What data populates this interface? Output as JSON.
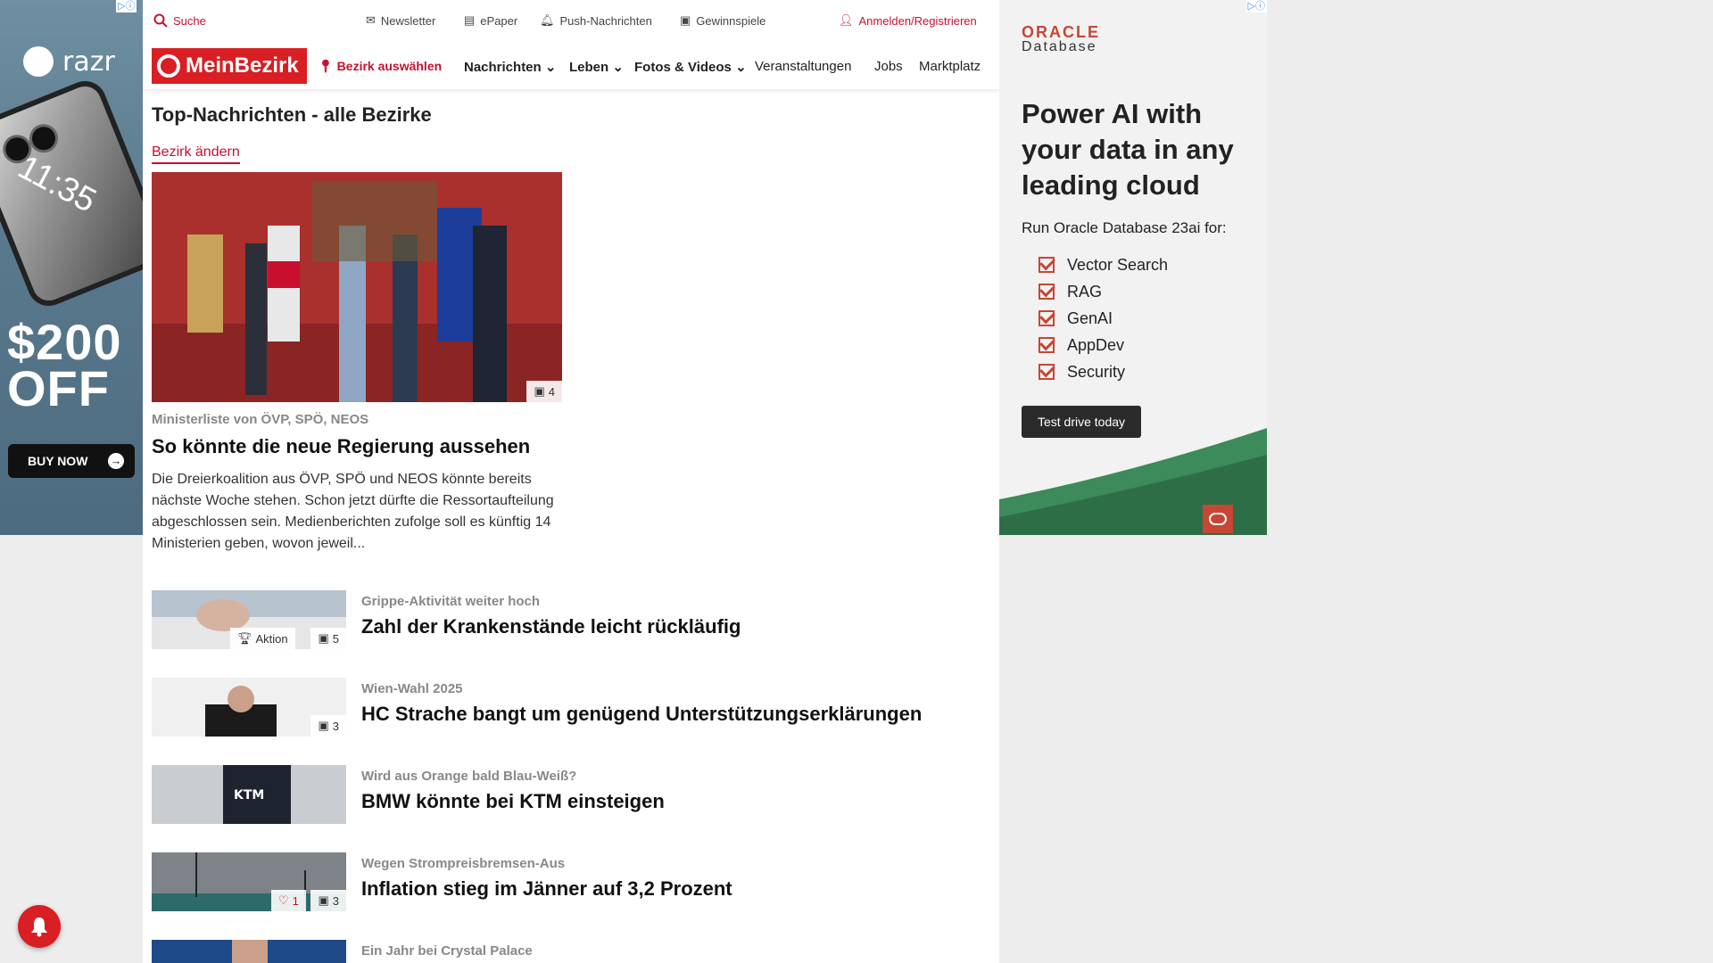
{
  "left_ad": {
    "brand": "razr",
    "clock": "11:35",
    "price_line1": "$200",
    "price_line2": "OFF",
    "button": "BUY NOW"
  },
  "topbar": {
    "search": "Suche",
    "newsletter": "Newsletter",
    "epaper": "ePaper",
    "push": "Push-Nachrichten",
    "games": "Gewinnspiele",
    "login": "Anmelden/Registrieren"
  },
  "nav": {
    "logo": "MeinBezirk",
    "district": "Bezirk auswählen",
    "items": [
      "Nachrichten",
      "Leben",
      "Fotos & Videos",
      "Veranstaltungen",
      "Jobs",
      "Marktplatz"
    ]
  },
  "section_title": "Top-Nachrichten - alle Bezirke",
  "change_district": "Bezirk ändern",
  "lead": {
    "image_count": "4",
    "kicker": "Ministerliste von ÖVP, SPÖ, NEOS",
    "title": "So könnte die neue Regierung aussehen",
    "teaser": "Die Dreierkoalition aus ÖVP, SPÖ und NEOS könnte bereits nächste Woche stehen. Schon jetzt dürfte die Ressortaufteilung abgeschlossen sein. Medienberichten zufolge soll es künftig 14 Ministerien geben, wovon jeweil..."
  },
  "articles": [
    {
      "kicker": "Grippe-Aktivität weiter hoch",
      "title": "Zahl der Krankenstände leicht rückläufig",
      "action": "Aktion",
      "images": "5"
    },
    {
      "kicker": "Wien-Wahl 2025",
      "title": "HC Strache bangt um genügend Unterstützungserklärungen",
      "images": "3"
    },
    {
      "kicker": "Wird aus Orange bald Blau-Weiß?",
      "title": "BMW könnte bei KTM einsteigen"
    },
    {
      "kicker": "Wegen Strompreisbremsen-Aus",
      "title": "Inflation stieg im Jänner auf 3,2 Prozent",
      "likes": "1",
      "images": "3"
    },
    {
      "kicker": "Ein Jahr bei Crystal Palace",
      "title": ""
    }
  ],
  "right_ad": {
    "logo_line1": "ORACLE",
    "logo_line2": "Database",
    "headline": "Power AI with your data in any leading cloud",
    "sub": "Run Oracle Database 23ai for:",
    "features": [
      "Vector Search",
      "RAG",
      "GenAI",
      "AppDev",
      "Security"
    ],
    "cta": "Test drive today"
  },
  "colors": {
    "brand_red": "#d91e24",
    "oracle_red": "#c74634"
  }
}
